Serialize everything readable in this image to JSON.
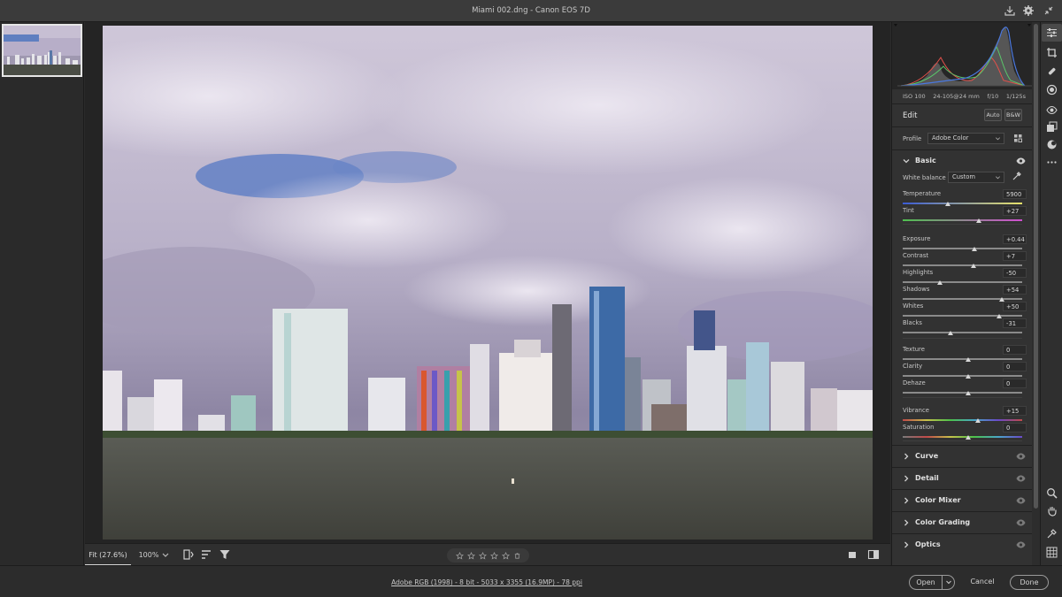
{
  "window": {
    "title": "Miami 002.dng  -  Canon EOS 7D",
    "icons": [
      "save-icon",
      "gear-icon",
      "collapse-icon"
    ]
  },
  "filmstrip": {
    "thumbnail_alt": "Miami skyline thumbnail"
  },
  "view_toolbar": {
    "fit_label": "Fit (27.6%)",
    "zoom_label": "100%",
    "rating_stars": 5,
    "icons": [
      "compare-icon",
      "sort-icon",
      "filter-icon",
      "star-icon",
      "trash-icon",
      "single-view-icon",
      "split-view-icon"
    ]
  },
  "status": {
    "info": "Adobe RGB (1998) - 8 bit - 5033 x 3355 (16.9MP) - 78 ppi",
    "open_label": "Open",
    "cancel_label": "Cancel",
    "done_label": "Done"
  },
  "exif": {
    "iso": "ISO 100",
    "lens": "24-105@24 mm",
    "aperture": "f/10",
    "shutter": "1/125s"
  },
  "edit": {
    "title": "Edit",
    "auto_label": "Auto",
    "bw_label": "B&W",
    "profile_label": "Profile",
    "profile_value": "Adobe Color"
  },
  "basic": {
    "title": "Basic",
    "wb_label": "White balance",
    "wb_value": "Custom",
    "sliders": [
      {
        "label": "Temperature",
        "value": "5900",
        "pos": 0.38
      },
      {
        "label": "Tint",
        "value": "+27",
        "pos": 0.64
      },
      {
        "label": "Exposure",
        "value": "+0.44",
        "pos": 0.6
      },
      {
        "label": "Contrast",
        "value": "+7",
        "pos": 0.59
      },
      {
        "label": "Highlights",
        "value": "-50",
        "pos": 0.31
      },
      {
        "label": "Shadows",
        "value": "+54",
        "pos": 0.83
      },
      {
        "label": "Whites",
        "value": "+50",
        "pos": 0.81
      },
      {
        "label": "Blacks",
        "value": "-31",
        "pos": 0.4
      },
      {
        "label": "Texture",
        "value": "0",
        "pos": 0.55
      },
      {
        "label": "Clarity",
        "value": "0",
        "pos": 0.55
      },
      {
        "label": "Dehaze",
        "value": "0",
        "pos": 0.55
      },
      {
        "label": "Vibrance",
        "value": "+15",
        "pos": 0.63
      },
      {
        "label": "Saturation",
        "value": "0",
        "pos": 0.55
      }
    ]
  },
  "sections": [
    "Curve",
    "Detail",
    "Color Mixer",
    "Color Grading",
    "Optics"
  ],
  "tools": [
    "edit-sliders-icon",
    "crop-icon",
    "healing-icon",
    "mask-icon",
    "redeye-icon",
    "snapshots-icon",
    "presets-icon",
    "more-icon",
    "zoom-icon",
    "hand-icon",
    "sampler-icon",
    "grid-icon"
  ]
}
